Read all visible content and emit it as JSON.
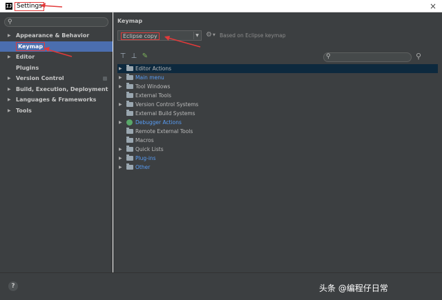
{
  "window": {
    "app_icon_text": "IJ",
    "title": "Settings",
    "close_glyph": "×"
  },
  "sidebar": {
    "search_placeholder": "",
    "items": [
      {
        "label": "Appearance & Behavior",
        "expandable": true
      },
      {
        "label": "Keymap",
        "expandable": false,
        "selected": true
      },
      {
        "label": "Editor",
        "expandable": true
      },
      {
        "label": "Plugins",
        "expandable": false
      },
      {
        "label": "Version Control",
        "expandable": true
      },
      {
        "label": "Build, Execution, Deployment",
        "expandable": true
      },
      {
        "label": "Languages & Frameworks",
        "expandable": true
      },
      {
        "label": "Tools",
        "expandable": true
      }
    ]
  },
  "main": {
    "title": "Keymap",
    "keymap_select": {
      "value": "Eclipse copy"
    },
    "based_on": "Based on Eclipse keymap",
    "filter_placeholder": "",
    "tree": [
      {
        "label": "Editor Actions",
        "icon": "folder-icon",
        "expandable": true,
        "selected": true,
        "link": false
      },
      {
        "label": "Main menu",
        "icon": "folder-icon",
        "expandable": true,
        "link": true
      },
      {
        "label": "Tool Windows",
        "icon": "folder-icon",
        "expandable": true,
        "link": false
      },
      {
        "label": "External Tools",
        "icon": "folder-icon",
        "expandable": false,
        "link": false
      },
      {
        "label": "Version Control Systems",
        "icon": "folder-icon",
        "expandable": true,
        "link": false
      },
      {
        "label": "External Build Systems",
        "icon": "folder-icon",
        "expandable": false,
        "link": false
      },
      {
        "label": "Debugger Actions",
        "icon": "debug-icon",
        "expandable": true,
        "link": true
      },
      {
        "label": "Remote External Tools",
        "icon": "folder-icon",
        "expandable": false,
        "link": false
      },
      {
        "label": "Macros",
        "icon": "folder-icon",
        "expandable": false,
        "link": false
      },
      {
        "label": "Quick Lists",
        "icon": "folder-icon",
        "expandable": true,
        "link": false
      },
      {
        "label": "Plug-ins",
        "icon": "folder-icon",
        "expandable": true,
        "link": true
      },
      {
        "label": "Other",
        "icon": "folder-icon",
        "expandable": true,
        "link": true
      }
    ]
  },
  "footer": {
    "help_label": "?",
    "watermark": "头条 @编程仔日常"
  },
  "colors": {
    "panel_bg": "#3c3f41",
    "selection": "#4b6eaf",
    "tree_selection": "#0d293e",
    "link": "#589df6",
    "annotation": "#e23a3a"
  }
}
